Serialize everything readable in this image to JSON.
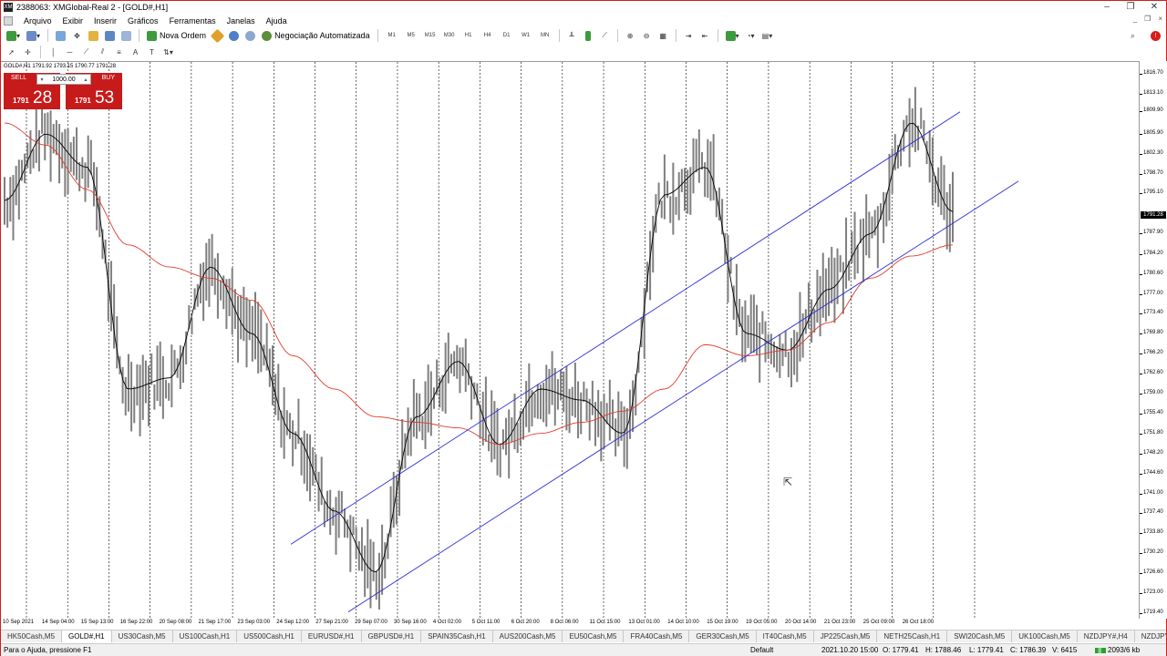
{
  "window": {
    "title": "2388063: XMGlobal-Real 2 - [GOLD#,H1]",
    "controls": [
      "–",
      "❐",
      "✕"
    ]
  },
  "menu": {
    "items": [
      "Arquivo",
      "Exibir",
      "Inserir",
      "Gráficos",
      "Ferramentas",
      "Janelas",
      "Ajuda"
    ],
    "mdi_controls": [
      "_",
      "❐",
      "×"
    ]
  },
  "toolbar": {
    "new_order": "Nova Ordem",
    "auto_trading": "Negociação Automatizada",
    "timeframes": [
      "M1",
      "M5",
      "M15",
      "M30",
      "H1",
      "H4",
      "D1",
      "W1",
      "MN"
    ]
  },
  "chart": {
    "symbol_line": "GOLD#,H1  1791.92 1793.15 1790.77 1791.28",
    "one_click": {
      "sell_label": "SELL",
      "buy_label": "BUY",
      "lot": "1000.00",
      "sell_small": "1791",
      "sell_big": "28",
      "buy_small": "1791",
      "buy_big": "53"
    },
    "price_labels": [
      "1816.70",
      "1813.10",
      "1809.90",
      "1805.90",
      "1802.30",
      "1798.70",
      "1795.10",
      "1791.28",
      "1787.90",
      "1784.20",
      "1780.60",
      "1777.00",
      "1773.40",
      "1769.80",
      "1766.20",
      "1762.60",
      "1759.00",
      "1755.40",
      "1751.80",
      "1748.20",
      "1744.60",
      "1741.00",
      "1737.40",
      "1733.80",
      "1730.20",
      "1726.60",
      "1723.00",
      "1719.40"
    ],
    "current_price": "1791.28",
    "time_labels": [
      "10 Sep 2021",
      "14 Sep 04:00",
      "15 Sep 13:00",
      "16 Sep 22:00",
      "20 Sep 08:00",
      "21 Sep 17:00",
      "23 Sep 03:00",
      "24 Sep 12:00",
      "27 Sep 21:00",
      "29 Sep 07:00",
      "30 Sep 16:00",
      "4 Oct 02:00",
      "5 Oct 11:00",
      "6 Oct 20:00",
      "8 Oct 06:00",
      "11 Oct 15:00",
      "13 Oct 01:00",
      "14 Oct 10:00",
      "15 Oct 19:00",
      "19 Oct 05:00",
      "20 Oct 14:00",
      "21 Oct 23:00",
      "25 Oct 09:00",
      "26 Oct 18:00"
    ],
    "colors": {
      "price_bars": "#7f7f7f",
      "ma_fast": "#000000",
      "ma_slow": "#e03c2c",
      "channel": "#2b2bd9",
      "grid": "#000000"
    }
  },
  "chart_data": {
    "type": "line",
    "title": "",
    "xlabel": "",
    "ylabel": "",
    "ylim": [
      1719.4,
      1816.7
    ],
    "x": [
      "10 Sep",
      "14 Sep",
      "15 Sep",
      "16 Sep",
      "20 Sep",
      "21 Sep",
      "23 Sep",
      "24 Sep",
      "27 Sep",
      "29 Sep",
      "30 Sep",
      "4 Oct",
      "5 Oct",
      "6 Oct",
      "8 Oct",
      "11 Oct",
      "13 Oct",
      "14 Oct",
      "15 Oct",
      "19 Oct",
      "20 Oct",
      "21 Oct",
      "25 Oct",
      "26 Oct"
    ],
    "series": [
      {
        "values": [
          1794,
          1806,
          1800,
          1760,
          1762,
          1782,
          1770,
          1752,
          1738,
          1727,
          1755,
          1765,
          1750,
          1760,
          1758,
          1752,
          1795,
          1800,
          1770,
          1767,
          1778,
          1788,
          1808,
          1792
        ]
      },
      {
        "values": [
          1808,
          1804,
          1796,
          1786,
          1782,
          1780,
          1776,
          1766,
          1760,
          1755,
          1754,
          1753,
          1750,
          1752,
          1754,
          1756,
          1760,
          1768,
          1766,
          1767,
          1772,
          1780,
          1784,
          1786
        ]
      }
    ],
    "grid": true,
    "legend": "none"
  },
  "tabs": [
    "HK50Cash,M5",
    "GOLD#,H1",
    "US30Cash,M5",
    "US100Cash,H1",
    "US500Cash,H1",
    "EURUSD#,H1",
    "GBPUSD#,H1",
    "SPAIN35Cash,H1",
    "AUS200Cash,M5",
    "EU50Cash,M5",
    "FRA40Cash,M5",
    "GER30Cash,M5",
    "IT40Cash,M5",
    "JP225Cash,M5",
    "NETH25Cash,H1",
    "SWI20Cash,M5",
    "UK100Cash,M5",
    "NZDJPY#,H4",
    "NZDJPY#,H1",
    "NZD"
  ],
  "status": {
    "help": "Para o Ajuda, pressione F1",
    "profile": "Default",
    "datetime": "2021.10.20 15:00",
    "open": "O: 1779.41",
    "high": "H: 1788.46",
    "low": "L: 1779.41",
    "close": "C: 1786.39",
    "volume": "V: 6415",
    "traffic": "2093/6 kb"
  }
}
